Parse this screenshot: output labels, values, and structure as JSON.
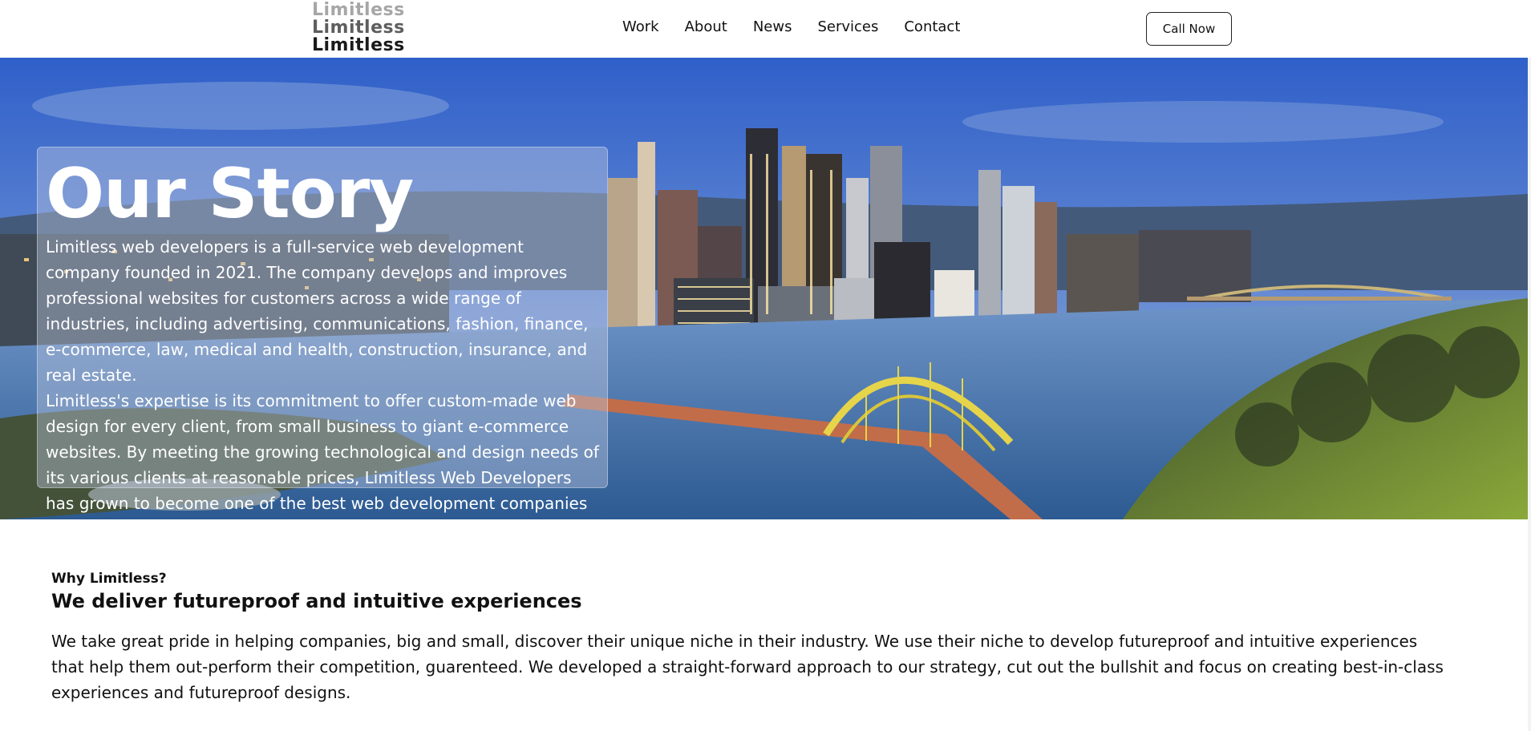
{
  "logo": {
    "lines": [
      "Limitless",
      "Limitless",
      "Limitless"
    ]
  },
  "nav": {
    "items": [
      "Work",
      "About",
      "News",
      "Services",
      "Contact"
    ]
  },
  "header": {
    "cta_label": "Call Now"
  },
  "hero": {
    "title": "Our Story",
    "paragraphs": [
      "Limitless web developers is a full-service web development company founded in 2021. The company develops and improves professional websites for customers across a wide range of industries, including advertising, communications, fashion, finance, e-commerce, law, medical and health, construction, insurance, and real estate.",
      "Limitless's expertise is its commitment to offer custom-made web design for every client, from small business to giant e-commerce websites. By meeting the growing technological and design needs of its various clients at reasonable prices, Limitless Web Developers has grown to become one of the best web development companies in the area."
    ],
    "image": "city-skyline-river-bridge-dusk"
  },
  "why": {
    "kicker": "Why Limitless?",
    "title": "We deliver futureproof and intuitive experiences",
    "body": "We take great pride in helping companies, big and small, discover their unique niche in their industry. We use their niche to develop futureproof and intuitive experiences that help them out-perform their competition, guarenteed. We developed a straight-forward approach to our strategy, cut out the bullshit and focus on creating best-in-class experiences and futureproof designs."
  },
  "colors": {
    "sky_top": "#3e6fd6",
    "sky_bottom": "#7ea0d8",
    "river": "#3d6ea8",
    "bridge": "#e8d84a",
    "foliage": "#6b8a2a"
  }
}
